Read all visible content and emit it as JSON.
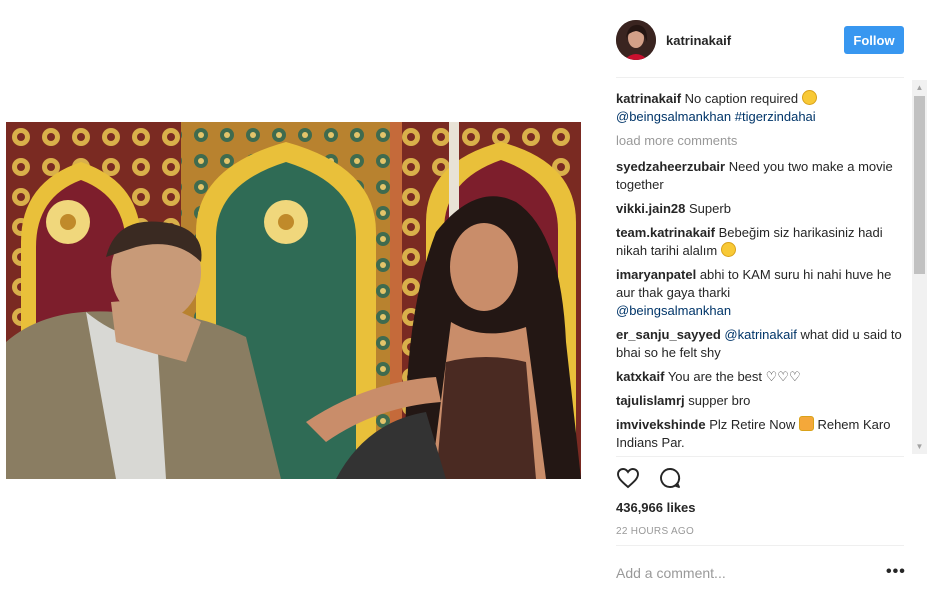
{
  "post": {
    "username": "katrinakaif",
    "follow_label": "Follow"
  },
  "caption": {
    "username": "katrinakaif",
    "text": "No caption required",
    "mention": "@beingsalmankhan",
    "hashtag": "#tigerzindahai"
  },
  "load_more_label": "load more comments",
  "comments": [
    {
      "user": "syedzaheerzubair",
      "text": "Need you two make a movie together"
    },
    {
      "user": "vikki.jain28",
      "text": "Superb"
    },
    {
      "user": "team.katrinakaif",
      "text": "Bebeğim siz harikasiniz hadi nikah tarihi alalım"
    },
    {
      "user": "imaryanpatel",
      "text": "abhi to KAM suru hi nahi huve he aur thak gaya tharki",
      "mention": "@beingsalmankhan"
    },
    {
      "user": "er_sanju_sayyed",
      "mention": "@katrinakaif",
      "text": "what did u said to bhai so he felt shy"
    },
    {
      "user": "katxkaif",
      "text": "You are the best ♡♡♡"
    },
    {
      "user": "tajulislamrj",
      "text": "supper bro"
    },
    {
      "user": "imvivekshinde",
      "text": "Plz Retire Now",
      "text2": "Rehem Karo Indians Par."
    }
  ],
  "likes_label": "436,966 likes",
  "timestamp": "22 HOURS AGO",
  "add_comment_placeholder": "Add a comment...",
  "more_label": "•••",
  "icons": {
    "like": "heart-icon",
    "comment": "comment-bubble-icon",
    "more": "more-options-icon"
  },
  "colors": {
    "follow_button": "#3897f0",
    "link": "#003569",
    "muted": "#999999"
  }
}
